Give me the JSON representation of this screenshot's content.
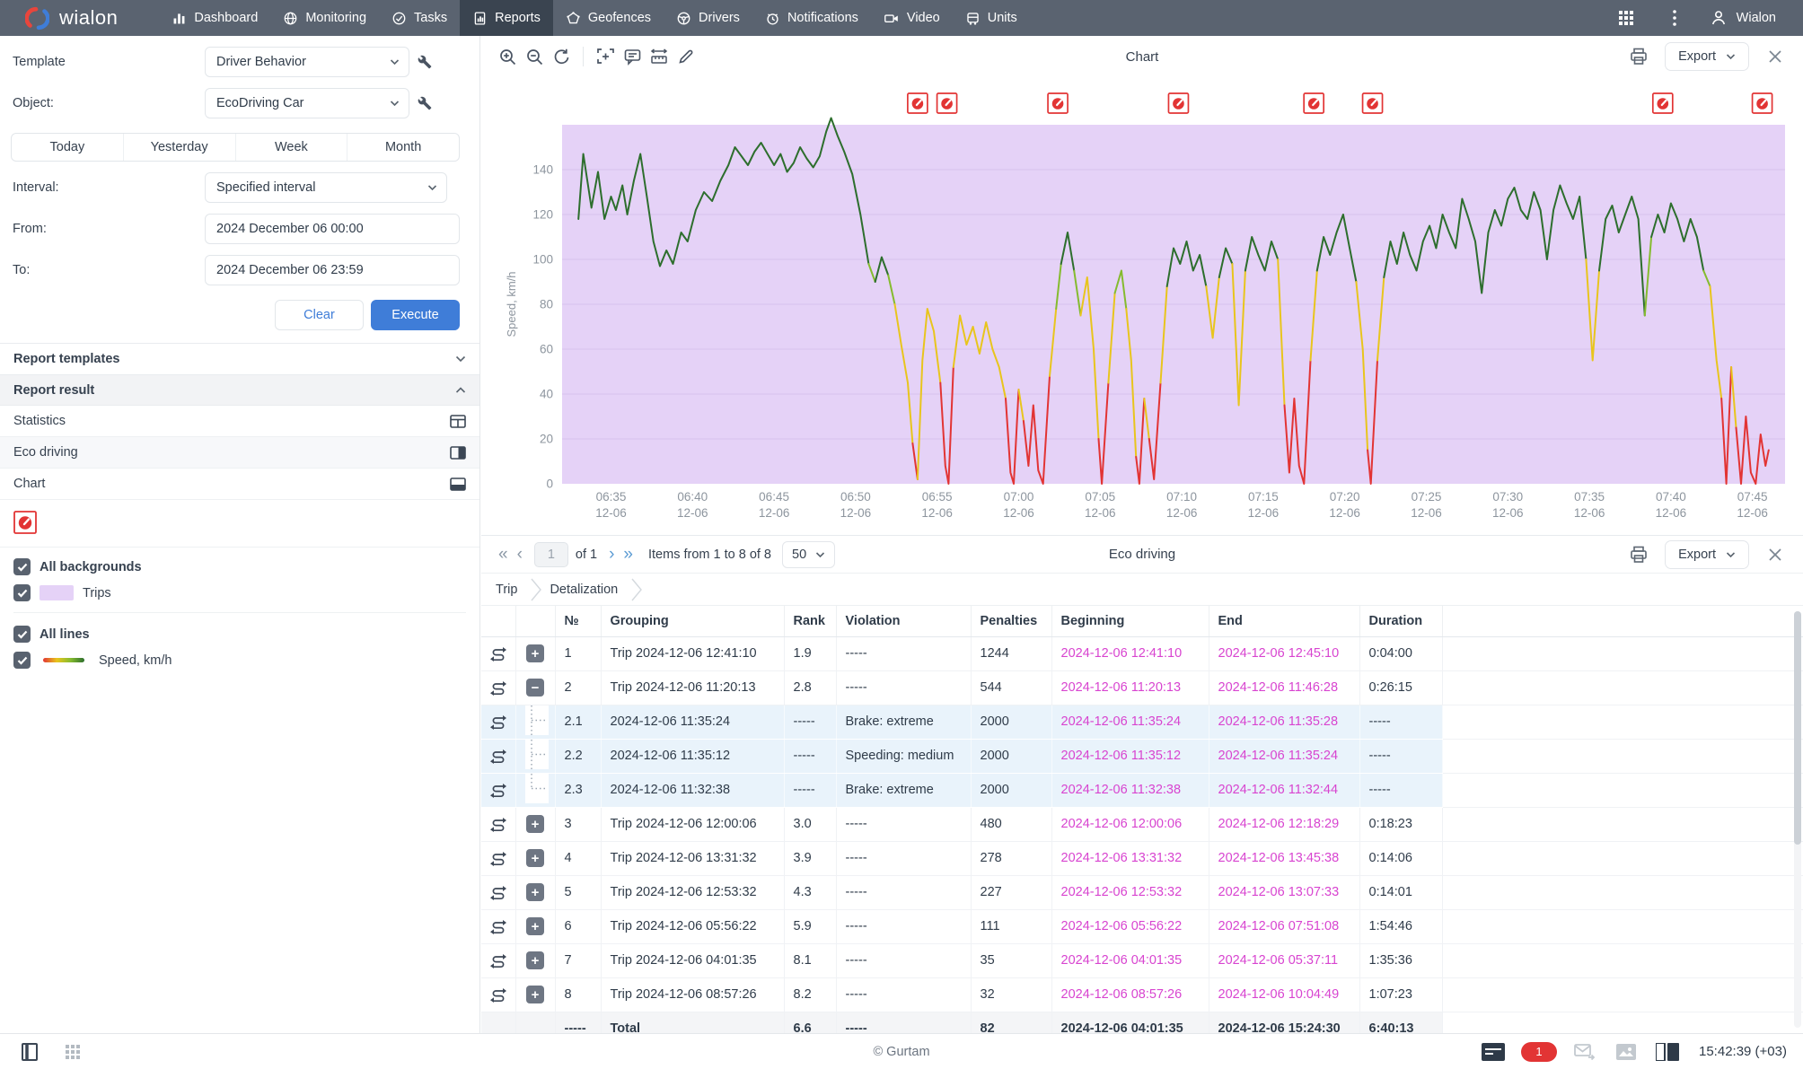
{
  "colors": {
    "accent": "#3f7dd8",
    "magenta": "#d844d0",
    "trip_background": "#e5d2f7",
    "violation_red": "#e23434",
    "nav_bg": "#5a6370"
  },
  "nav": {
    "brand": "wialon",
    "items": [
      {
        "label": "Dashboard",
        "icon": "dashboard-icon",
        "active": false
      },
      {
        "label": "Monitoring",
        "icon": "monitoring-icon",
        "active": false
      },
      {
        "label": "Tasks",
        "icon": "tasks-icon",
        "active": false
      },
      {
        "label": "Reports",
        "icon": "reports-icon",
        "active": true
      },
      {
        "label": "Geofences",
        "icon": "geofences-icon",
        "active": false
      },
      {
        "label": "Drivers",
        "icon": "drivers-icon",
        "active": false
      },
      {
        "label": "Notifications",
        "icon": "notifications-icon",
        "active": false
      },
      {
        "label": "Video",
        "icon": "video-icon",
        "active": false
      },
      {
        "label": "Units",
        "icon": "units-icon",
        "active": false
      }
    ],
    "user_label": "Wialon"
  },
  "sidebar": {
    "template_label": "Template",
    "template_value": "Driver Behavior",
    "object_label": "Object:",
    "object_value": "EcoDriving Car",
    "quick_ranges": [
      "Today",
      "Yesterday",
      "Week",
      "Month"
    ],
    "interval_label": "Interval:",
    "interval_value": "Specified interval",
    "from_label": "From:",
    "from_value": "2024 December 06 00:00",
    "to_label": "To:",
    "to_value": "2024 December 06 23:59",
    "clear_label": "Clear",
    "execute_label": "Execute",
    "templates_section": "Report templates",
    "result_section": "Report result",
    "result_items": [
      {
        "label": "Statistics",
        "icon": "statistics-table-icon"
      },
      {
        "label": "Eco driving",
        "icon": "eco-driving-table-icon"
      },
      {
        "label": "Chart",
        "icon": "chart-table-icon"
      }
    ],
    "legend": {
      "all_backgrounds": "All backgrounds",
      "trips": "Trips",
      "all_lines": "All lines",
      "speed": "Speed, km/h"
    }
  },
  "chart_panel": {
    "title": "Chart",
    "export_label": "Export"
  },
  "chart_data": {
    "type": "line",
    "title": "Chart",
    "ylabel": "Speed, km/h",
    "yticks": [
      0,
      20,
      40,
      60,
      80,
      100,
      120,
      140
    ],
    "ylim": [
      0,
      160
    ],
    "grid": "horizontal",
    "legend_position": "none",
    "x_start_time": "06:32",
    "x_domain_minutes": 75,
    "x_tick_times": [
      "06:35",
      "06:40",
      "06:45",
      "06:50",
      "06:55",
      "07:00",
      "07:05",
      "07:10",
      "07:15",
      "07:20",
      "07:25",
      "07:30",
      "07:35",
      "07:40",
      "07:45"
    ],
    "x_tick_date": "12-06",
    "plot_bg": "#e5d2f7",
    "speed_bands": [
      {
        "min": 95,
        "color": "#2d6e2d"
      },
      {
        "min": 85,
        "color": "#85bb2f"
      },
      {
        "min": 28,
        "color": "#e8c51d"
      },
      {
        "min": -999,
        "color": "#e23434"
      }
    ],
    "violation_marker_minutes": [
      21.8,
      23.6,
      30.4,
      37.8,
      46.1,
      49.7,
      67.5,
      73.6
    ],
    "points": [
      [
        1,
        118
      ],
      [
        1.3,
        147
      ],
      [
        1.8,
        123
      ],
      [
        2.2,
        139
      ],
      [
        2.6,
        118
      ],
      [
        3,
        128
      ],
      [
        3.3,
        122
      ],
      [
        3.7,
        133
      ],
      [
        4,
        120
      ],
      [
        4.4,
        135
      ],
      [
        4.8,
        147
      ],
      [
        5.2,
        128
      ],
      [
        5.6,
        108
      ],
      [
        6,
        97
      ],
      [
        6.4,
        104
      ],
      [
        6.8,
        98
      ],
      [
        7.3,
        112
      ],
      [
        7.7,
        108
      ],
      [
        8.2,
        122
      ],
      [
        8.7,
        130
      ],
      [
        9.2,
        126
      ],
      [
        9.7,
        135
      ],
      [
        10.2,
        142
      ],
      [
        10.6,
        150
      ],
      [
        11,
        146
      ],
      [
        11.4,
        142
      ],
      [
        11.8,
        148
      ],
      [
        12.2,
        152
      ],
      [
        12.6,
        147
      ],
      [
        13,
        142
      ],
      [
        13.4,
        147
      ],
      [
        13.8,
        139
      ],
      [
        14.2,
        143
      ],
      [
        14.6,
        150
      ],
      [
        15,
        145
      ],
      [
        15.4,
        141
      ],
      [
        15.8,
        146
      ],
      [
        16.2,
        157
      ],
      [
        16.5,
        163
      ],
      [
        16.9,
        155
      ],
      [
        17.3,
        148
      ],
      [
        17.8,
        138
      ],
      [
        18.3,
        120
      ],
      [
        18.8,
        98
      ],
      [
        19.2,
        90
      ],
      [
        19.6,
        101
      ],
      [
        20,
        93
      ],
      [
        20.4,
        80
      ],
      [
        20.8,
        62
      ],
      [
        21.2,
        45
      ],
      [
        21.5,
        18
      ],
      [
        21.8,
        2
      ],
      [
        22.1,
        55
      ],
      [
        22.4,
        78
      ],
      [
        22.8,
        68
      ],
      [
        23.2,
        45
      ],
      [
        23.5,
        8
      ],
      [
        23.7,
        0
      ],
      [
        24,
        52
      ],
      [
        24.4,
        75
      ],
      [
        24.8,
        62
      ],
      [
        25.2,
        70
      ],
      [
        25.6,
        58
      ],
      [
        26,
        72
      ],
      [
        26.4,
        60
      ],
      [
        26.8,
        52
      ],
      [
        27.2,
        38
      ],
      [
        27.5,
        5
      ],
      [
        27.7,
        0
      ],
      [
        28,
        42
      ],
      [
        28.3,
        28
      ],
      [
        28.6,
        8
      ],
      [
        28.9,
        35
      ],
      [
        29.2,
        6
      ],
      [
        29.5,
        0
      ],
      [
        29.9,
        48
      ],
      [
        30.3,
        78
      ],
      [
        30.6,
        98
      ],
      [
        31,
        112
      ],
      [
        31.4,
        95
      ],
      [
        31.8,
        75
      ],
      [
        32.2,
        92
      ],
      [
        32.6,
        60
      ],
      [
        32.9,
        20
      ],
      [
        33.1,
        0
      ],
      [
        33.5,
        45
      ],
      [
        33.9,
        85
      ],
      [
        34.3,
        95
      ],
      [
        34.6,
        78
      ],
      [
        34.9,
        55
      ],
      [
        35.2,
        12
      ],
      [
        35.4,
        0
      ],
      [
        35.7,
        38
      ],
      [
        36,
        20
      ],
      [
        36.3,
        2
      ],
      [
        36.7,
        45
      ],
      [
        37.1,
        88
      ],
      [
        37.5,
        105
      ],
      [
        37.9,
        98
      ],
      [
        38.3,
        108
      ],
      [
        38.7,
        95
      ],
      [
        39.1,
        102
      ],
      [
        39.5,
        88
      ],
      [
        39.9,
        65
      ],
      [
        40.3,
        92
      ],
      [
        40.7,
        105
      ],
      [
        41.1,
        98
      ],
      [
        41.5,
        35
      ],
      [
        41.9,
        95
      ],
      [
        42.3,
        110
      ],
      [
        42.7,
        102
      ],
      [
        43.1,
        95
      ],
      [
        43.5,
        108
      ],
      [
        43.9,
        100
      ],
      [
        44.3,
        35
      ],
      [
        44.6,
        5
      ],
      [
        44.9,
        38
      ],
      [
        45.2,
        8
      ],
      [
        45.5,
        0
      ],
      [
        45.9,
        55
      ],
      [
        46.3,
        95
      ],
      [
        46.7,
        110
      ],
      [
        47.1,
        102
      ],
      [
        47.5,
        112
      ],
      [
        47.9,
        120
      ],
      [
        48.3,
        105
      ],
      [
        48.7,
        90
      ],
      [
        49.1,
        60
      ],
      [
        49.4,
        15
      ],
      [
        49.6,
        0
      ],
      [
        50,
        55
      ],
      [
        50.4,
        92
      ],
      [
        50.8,
        108
      ],
      [
        51.2,
        98
      ],
      [
        51.6,
        112
      ],
      [
        52,
        102
      ],
      [
        52.4,
        95
      ],
      [
        52.8,
        108
      ],
      [
        53.2,
        115
      ],
      [
        53.6,
        105
      ],
      [
        54,
        120
      ],
      [
        54.4,
        112
      ],
      [
        54.8,
        105
      ],
      [
        55.2,
        127
      ],
      [
        55.6,
        118
      ],
      [
        56,
        108
      ],
      [
        56.4,
        85
      ],
      [
        56.8,
        112
      ],
      [
        57.2,
        122
      ],
      [
        57.6,
        115
      ],
      [
        58,
        127
      ],
      [
        58.4,
        132
      ],
      [
        58.8,
        122
      ],
      [
        59.2,
        118
      ],
      [
        59.6,
        130
      ],
      [
        60,
        122
      ],
      [
        60.4,
        100
      ],
      [
        60.8,
        122
      ],
      [
        61.2,
        133
      ],
      [
        61.6,
        125
      ],
      [
        62,
        118
      ],
      [
        62.4,
        128
      ],
      [
        62.8,
        100
      ],
      [
        63.2,
        55
      ],
      [
        63.6,
        95
      ],
      [
        64,
        118
      ],
      [
        64.4,
        124
      ],
      [
        64.8,
        112
      ],
      [
        65.2,
        120
      ],
      [
        65.6,
        128
      ],
      [
        66,
        118
      ],
      [
        66.4,
        75
      ],
      [
        66.8,
        110
      ],
      [
        67.2,
        120
      ],
      [
        67.6,
        112
      ],
      [
        68,
        125
      ],
      [
        68.4,
        118
      ],
      [
        68.8,
        108
      ],
      [
        69.2,
        118
      ],
      [
        69.6,
        110
      ],
      [
        70,
        95
      ],
      [
        70.4,
        88
      ],
      [
        70.8,
        55
      ],
      [
        71.1,
        38
      ],
      [
        71.4,
        0
      ],
      [
        71.7,
        52
      ],
      [
        72,
        25
      ],
      [
        72.3,
        0
      ],
      [
        72.6,
        30
      ],
      [
        72.9,
        5
      ],
      [
        73.2,
        0
      ],
      [
        73.5,
        22
      ],
      [
        73.8,
        8
      ],
      [
        74,
        15
      ]
    ]
  },
  "table_panel": {
    "title": "Eco driving",
    "export_label": "Export",
    "pagination": {
      "first": "«",
      "prev": "‹",
      "page": "1",
      "of": "of 1",
      "next": "›",
      "last": "»",
      "items": "Items from 1 to 8 of 8",
      "page_size": "50"
    },
    "breadcrumbs": [
      "Trip",
      "Detalization"
    ],
    "columns": [
      "№",
      "Grouping",
      "Rank",
      "Violation",
      "Penalties",
      "Beginning",
      "End",
      "Duration"
    ],
    "rows": [
      {
        "kind": "trip",
        "expand": "plus",
        "n": "1",
        "grouping": "Trip 2024-12-06 12:41:10",
        "rank": "1.9",
        "violation": "-----",
        "penalties": "1244",
        "beginning": "2024-12-06 12:41:10",
        "end": "2024-12-06 12:45:10",
        "duration": "0:04:00"
      },
      {
        "kind": "trip",
        "expand": "minus",
        "n": "2",
        "grouping": "Trip 2024-12-06 11:20:13",
        "rank": "2.8",
        "violation": "-----",
        "penalties": "544",
        "beginning": "2024-12-06 11:20:13",
        "end": "2024-12-06 11:46:28",
        "duration": "0:26:15"
      },
      {
        "kind": "detail",
        "branch": "mid",
        "n": "2.1",
        "grouping": "2024-12-06 11:35:24",
        "rank": "-----",
        "violation": "Brake: extreme",
        "penalties": "2000",
        "beginning": "2024-12-06 11:35:24",
        "end": "2024-12-06 11:35:28",
        "duration": "-----"
      },
      {
        "kind": "detail",
        "branch": "mid",
        "n": "2.2",
        "grouping": "2024-12-06 11:35:12",
        "rank": "-----",
        "violation": "Speeding: medium",
        "penalties": "2000",
        "beginning": "2024-12-06 11:35:12",
        "end": "2024-12-06 11:35:24",
        "duration": "-----"
      },
      {
        "kind": "detail",
        "branch": "last",
        "n": "2.3",
        "grouping": "2024-12-06 11:32:38",
        "rank": "-----",
        "violation": "Brake: extreme",
        "penalties": "2000",
        "beginning": "2024-12-06 11:32:38",
        "end": "2024-12-06 11:32:44",
        "duration": "-----"
      },
      {
        "kind": "trip",
        "expand": "plus",
        "n": "3",
        "grouping": "Trip 2024-12-06 12:00:06",
        "rank": "3.0",
        "violation": "-----",
        "penalties": "480",
        "beginning": "2024-12-06 12:00:06",
        "end": "2024-12-06 12:18:29",
        "duration": "0:18:23"
      },
      {
        "kind": "trip",
        "expand": "plus",
        "n": "4",
        "grouping": "Trip 2024-12-06 13:31:32",
        "rank": "3.9",
        "violation": "-----",
        "penalties": "278",
        "beginning": "2024-12-06 13:31:32",
        "end": "2024-12-06 13:45:38",
        "duration": "0:14:06"
      },
      {
        "kind": "trip",
        "expand": "plus",
        "n": "5",
        "grouping": "Trip 2024-12-06 12:53:32",
        "rank": "4.3",
        "violation": "-----",
        "penalties": "227",
        "beginning": "2024-12-06 12:53:32",
        "end": "2024-12-06 13:07:33",
        "duration": "0:14:01"
      },
      {
        "kind": "trip",
        "expand": "plus",
        "n": "6",
        "grouping": "Trip 2024-12-06 05:56:22",
        "rank": "5.9",
        "violation": "-----",
        "penalties": "111",
        "beginning": "2024-12-06 05:56:22",
        "end": "2024-12-06 07:51:08",
        "duration": "1:54:46"
      },
      {
        "kind": "trip",
        "expand": "plus",
        "n": "7",
        "grouping": "Trip 2024-12-06 04:01:35",
        "rank": "8.1",
        "violation": "-----",
        "penalties": "35",
        "beginning": "2024-12-06 04:01:35",
        "end": "2024-12-06 05:37:11",
        "duration": "1:35:36"
      },
      {
        "kind": "trip",
        "expand": "plus",
        "n": "8",
        "grouping": "Trip 2024-12-06 08:57:26",
        "rank": "8.2",
        "violation": "-----",
        "penalties": "32",
        "beginning": "2024-12-06 08:57:26",
        "end": "2024-12-06 10:04:49",
        "duration": "1:07:23"
      }
    ],
    "total": {
      "n": "-----",
      "grouping": "Total",
      "rank": "6.6",
      "violation": "-----",
      "penalties": "82",
      "beginning": "2024-12-06 04:01:35",
      "end": "2024-12-06 15:24:30",
      "duration": "6:40:13"
    }
  },
  "statusbar": {
    "copyright": "© Gurtam",
    "badge": "1",
    "time": "15:42:39 (+03)"
  }
}
